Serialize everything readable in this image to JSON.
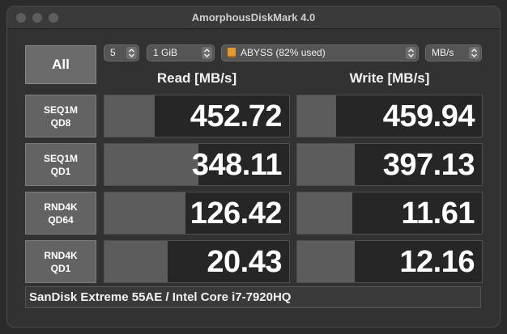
{
  "window": {
    "title": "AmorphousDiskMark 4.0"
  },
  "all_button": "All",
  "controls": {
    "count": "5",
    "size": "1 GiB",
    "drive": "ABYSS (82% used)",
    "unit": "MB/s"
  },
  "headers": {
    "read": "Read [MB/s]",
    "write": "Write [MB/s]"
  },
  "rows": [
    {
      "label1": "SEQ1M",
      "label2": "QD8",
      "read": "452.72",
      "write": "459.94",
      "read_fill": 0.27,
      "write_fill": 0.21
    },
    {
      "label1": "SEQ1M",
      "label2": "QD1",
      "read": "348.11",
      "write": "397.13",
      "read_fill": 0.51,
      "write_fill": 0.31
    },
    {
      "label1": "RND4K",
      "label2": "QD64",
      "read": "126.42",
      "write": "11.61",
      "read_fill": 0.44,
      "write_fill": 0.3
    },
    {
      "label1": "RND4K",
      "label2": "QD1",
      "read": "20.43",
      "write": "12.16",
      "read_fill": 0.34,
      "write_fill": 0.31
    }
  ],
  "comment": "SanDisk Extreme 55AE / Intel Core i7-7920HQ",
  "colors": {
    "bar": "#5c5c5c",
    "cell_bg": "#262626",
    "drive_icon": "#e49a2e"
  }
}
